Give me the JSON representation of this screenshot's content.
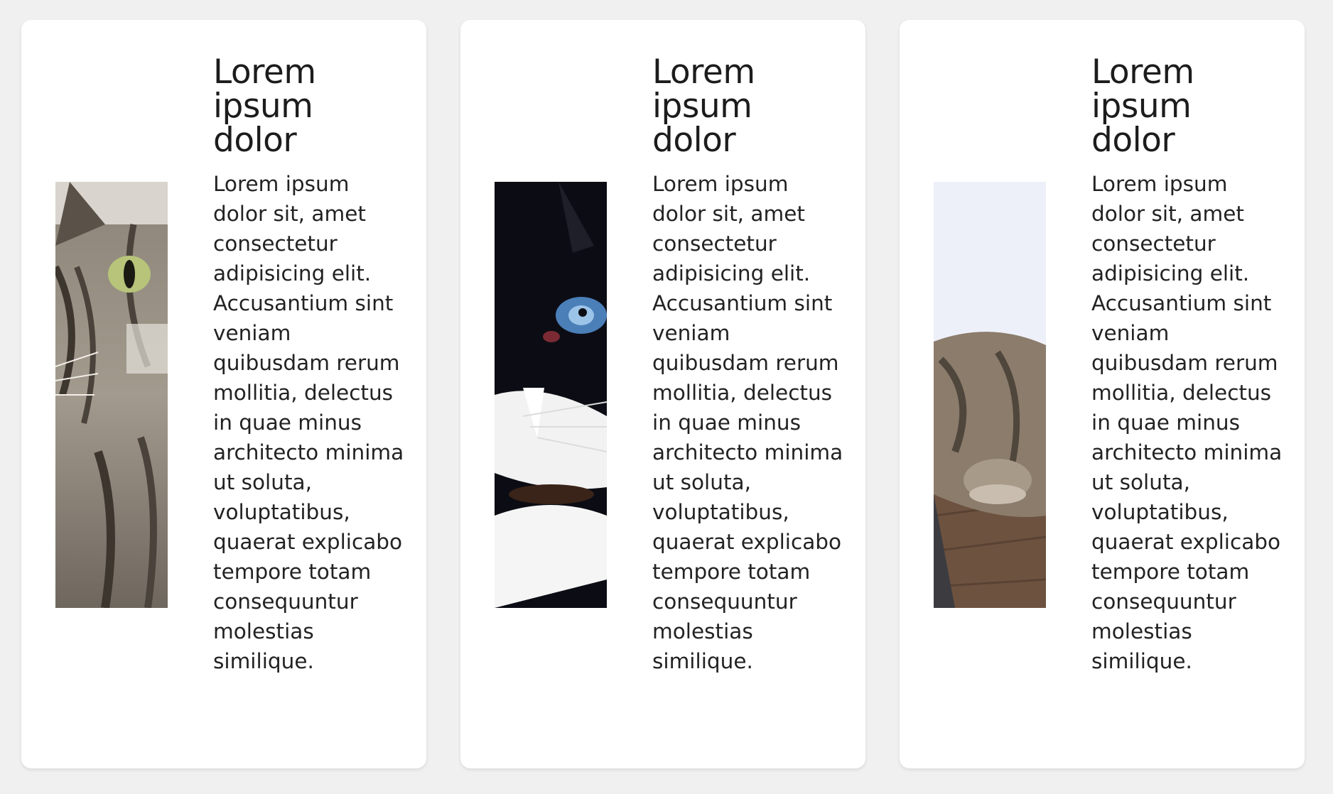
{
  "cards": [
    {
      "title": "Lorem ipsum dolor",
      "body": "Lorem ipsum dolor sit, amet consectetur adipisicing elit. Accusantium sint veniam quibusdam rerum mollitia, delectus in quae minus architecto minima ut soluta, voluptatibus, quaerat explicabo tempore totam consequuntur molestias similique.",
      "image_icon": "tabby-cat-photo"
    },
    {
      "title": "Lorem ipsum dolor",
      "body": "Lorem ipsum dolor sit, amet consectetur adipisicing elit. Accusantium sint veniam quibusdam rerum mollitia, delectus in quae minus architecto minima ut soluta, voluptatibus, quaerat explicabo tempore totam consequuntur molestias similique.",
      "image_icon": "black-white-cat-photo"
    },
    {
      "title": "Lorem ipsum dolor",
      "body": "Lorem ipsum dolor sit, amet consectetur adipisicing elit. Accusantium sint veniam quibusdam rerum mollitia, delectus in quae minus architecto minima ut soluta, voluptatibus, quaerat explicabo tempore totam consequuntur molestias similique.",
      "image_icon": "lying-cat-photo"
    }
  ],
  "colors": {
    "page_background": "#f0f0f0",
    "card_background": "#ffffff",
    "text": "#222222"
  }
}
